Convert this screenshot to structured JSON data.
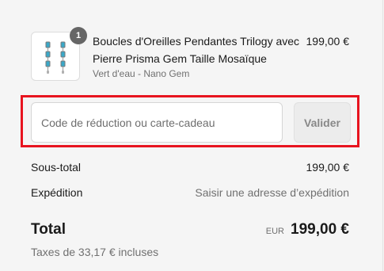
{
  "product": {
    "quantity": "1",
    "name": "Boucles d'Oreilles Pendantes Trilogy avec Pierre Prisma Gem Taille Mosaïque",
    "variant": "Vert d'eau - Nano Gem",
    "price": "199,00 €",
    "image_icon": "earrings-thumbnail-icon"
  },
  "discount": {
    "placeholder": "Code de réduction ou carte-cadeau",
    "value": "",
    "apply_label": "Valider"
  },
  "summary": {
    "subtotal_label": "Sous-total",
    "subtotal_value": "199,00 €",
    "shipping_label": "Expédition",
    "shipping_value": "Saisir une adresse d’expédition",
    "total_label": "Total",
    "currency": "EUR",
    "total_value": "199,00 €",
    "taxes_text": "Taxes de 33,17 € incluses"
  },
  "colors": {
    "highlight": "#e8141f",
    "badge": "#666666",
    "gem": "#3aa8c8"
  }
}
